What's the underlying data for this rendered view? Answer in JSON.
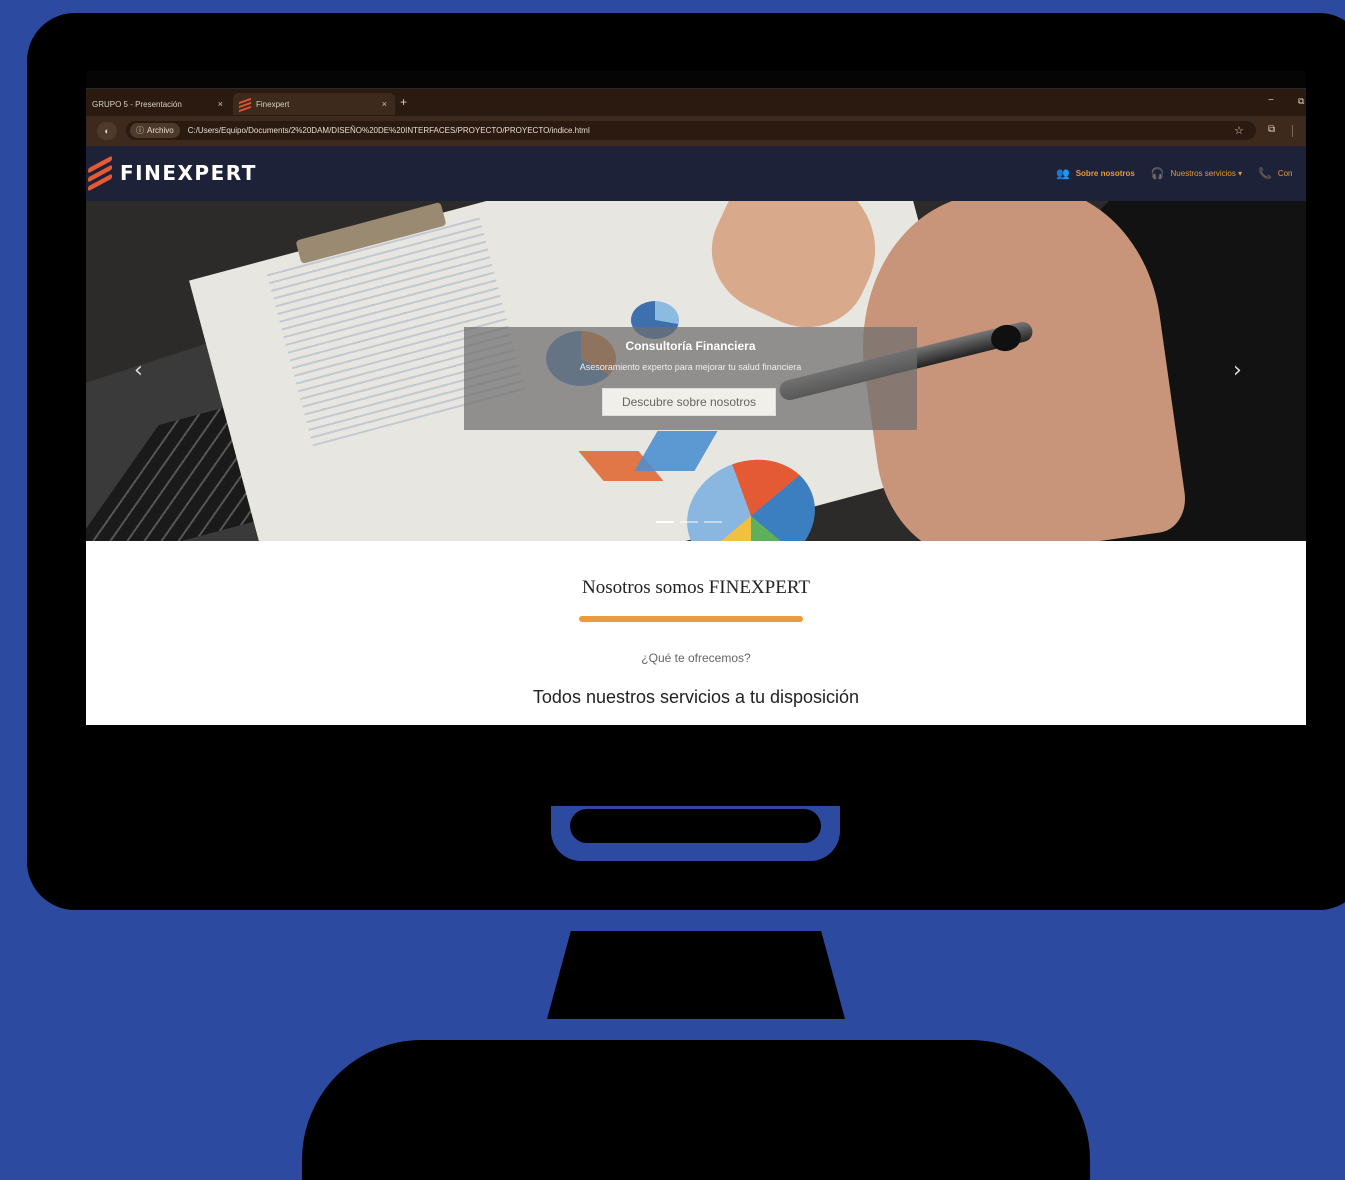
{
  "browser": {
    "tabs": [
      {
        "label": "GRUPO 5 - Presentación",
        "close": "×"
      },
      {
        "label": "Finexpert",
        "close": "×"
      }
    ],
    "new_tab": "+",
    "window_minimize": "−",
    "window_maximize": "⧉",
    "address": {
      "chip_label": "Archivo",
      "chip_icon": "ⓘ",
      "url": "C:/Users/Equipo/Documents/2%20DAM/DISEÑO%20DE%20INTERFACES/PROYECTO/PROYECTO/indice.html"
    },
    "bookmark_icon": "☆",
    "extensions_icon": "⧉"
  },
  "site": {
    "brand": "FINEXPERT",
    "nav": [
      {
        "icon": "users-icon",
        "glyph": "👥",
        "label": "Sobre nosotros"
      },
      {
        "icon": "headset-icon",
        "glyph": "🎧",
        "label": "Nuestros servicios ▾"
      },
      {
        "icon": "phone-icon",
        "glyph": "📞",
        "label": "Con"
      }
    ],
    "colors": {
      "accent": "#ec9a3c",
      "nav_bg": "#1e2238",
      "logo": "#e35a35"
    }
  },
  "hero": {
    "title": "Consultoría Financiera",
    "subtitle": "Asesoramiento experto para mejorar tu salud financiera",
    "button": "Descubre sobre nosotros",
    "prev": "‹",
    "next": "›",
    "slide_count": 3,
    "active_slide": 1
  },
  "about": {
    "title": "Nosotros somos FINEXPERT",
    "kicker": "¿Qué te ofrecemos?",
    "heading": "Todos nuestros servicios a tu disposición"
  }
}
